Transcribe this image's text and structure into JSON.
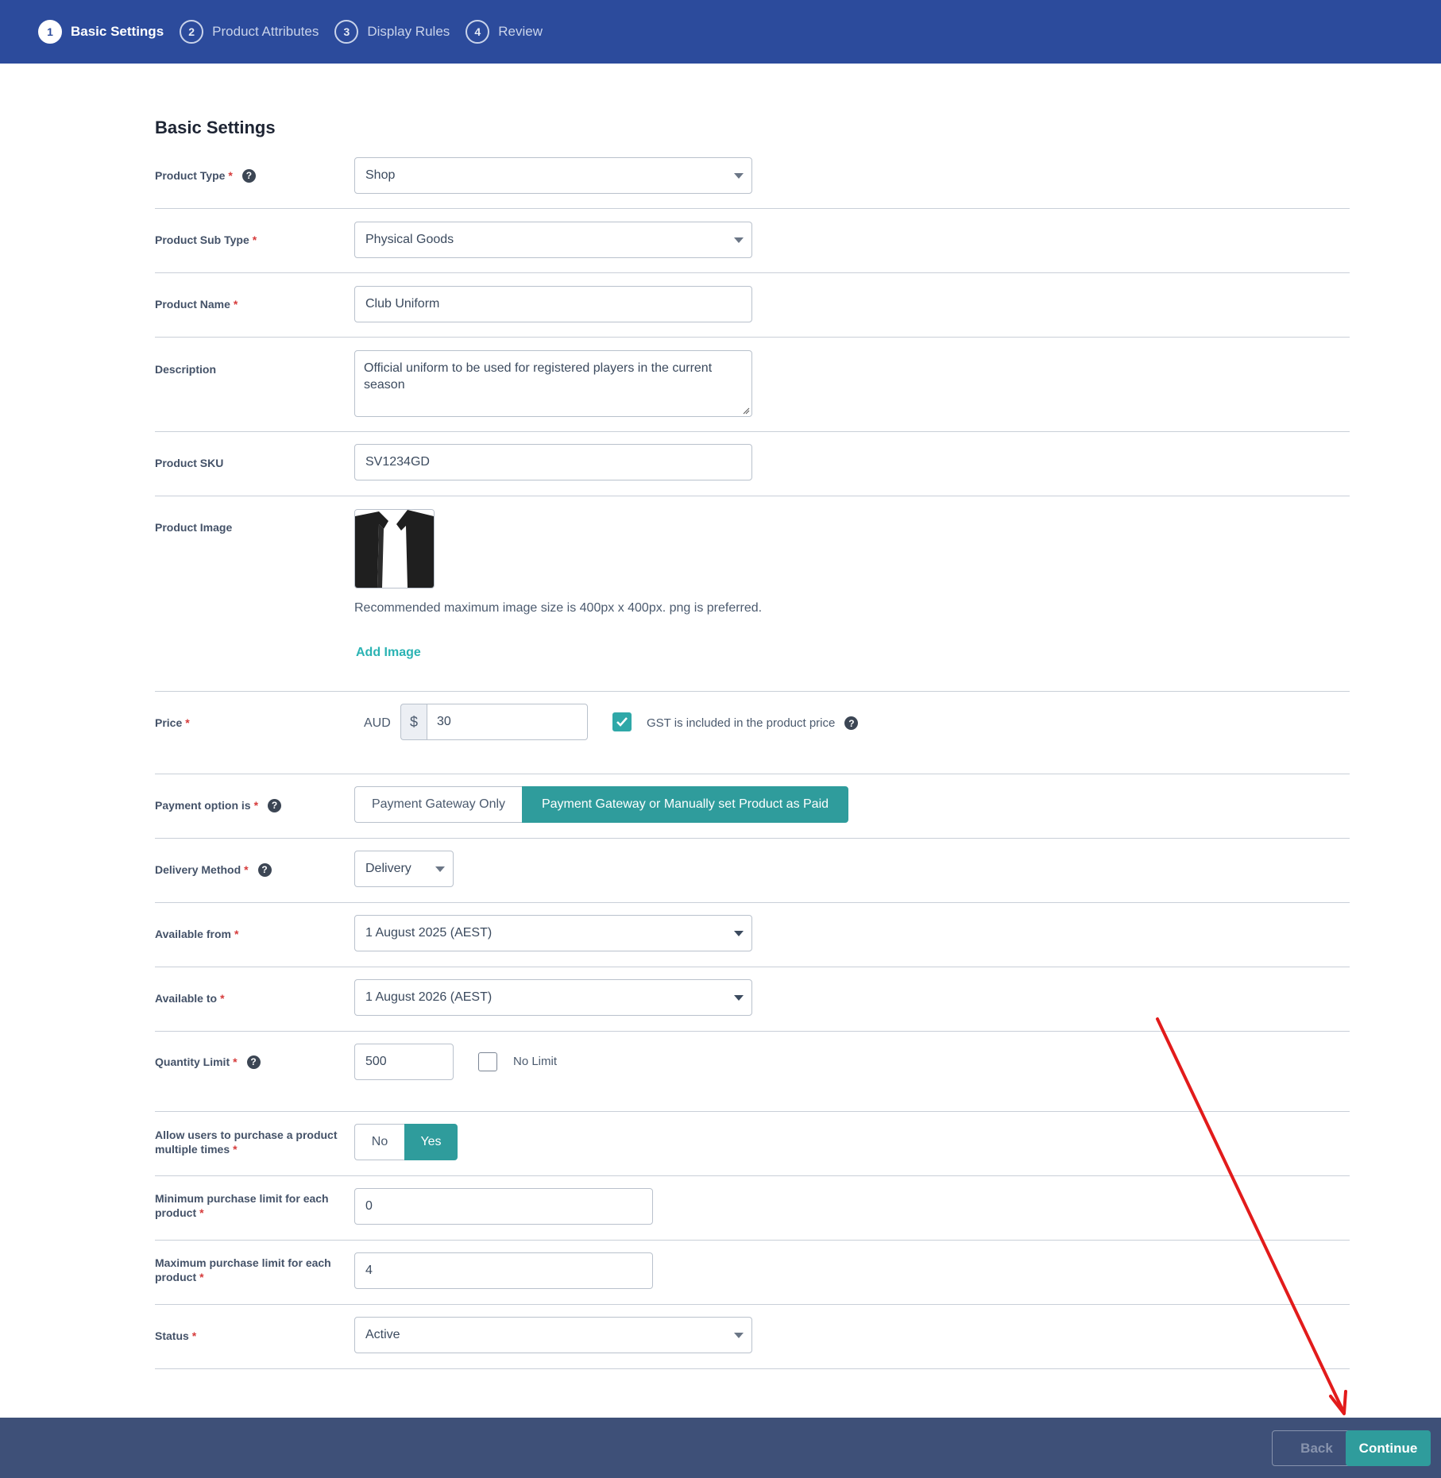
{
  "stepper": {
    "steps": [
      {
        "num": "1",
        "label": "Basic Settings"
      },
      {
        "num": "2",
        "label": "Product Attributes"
      },
      {
        "num": "3",
        "label": "Display Rules"
      },
      {
        "num": "4",
        "label": "Review"
      }
    ],
    "active_step": 1
  },
  "section_title": "Basic Settings",
  "required_mark": "*",
  "help_glyph": "?",
  "fields": {
    "product_type": {
      "label": "Product Type",
      "value": "Shop"
    },
    "product_sub_type": {
      "label": "Product Sub Type",
      "value": "Physical Goods"
    },
    "product_name": {
      "label": "Product Name",
      "value": "Club Uniform"
    },
    "description": {
      "label": "Description",
      "value": "Official uniform to be used for registered players in the current season"
    },
    "product_sku": {
      "label": "Product SKU",
      "value": "SV1234GD"
    },
    "product_image": {
      "label": "Product Image",
      "hint": "Recommended maximum image size is 400px x 400px. png is preferred.",
      "add_link": "Add Image"
    },
    "price": {
      "label": "Price",
      "currency": "AUD",
      "symbol": "$",
      "value": "30",
      "gst_checked": true,
      "gst_label": "GST is included in the product price"
    },
    "payment_option": {
      "label": "Payment option is",
      "options": [
        "Payment Gateway Only",
        "Payment Gateway or Manually set Product as Paid"
      ],
      "selected": "Payment Gateway or Manually set Product as Paid"
    },
    "delivery_method": {
      "label": "Delivery Method",
      "value": "Delivery"
    },
    "available_from": {
      "label": "Available from",
      "value": "1 August 2025 (AEST)"
    },
    "available_to": {
      "label": "Available to",
      "value": "1 August 2026 (AEST)"
    },
    "quantity_limit": {
      "label": "Quantity Limit",
      "value": "500",
      "no_limit_label": "No Limit",
      "no_limit_checked": false
    },
    "multiple_purchase": {
      "label_line1": "Allow users to purchase a product",
      "label_line2": "multiple times",
      "options": [
        "No",
        "Yes"
      ],
      "selected": "Yes"
    },
    "min_purchase": {
      "label_line1": "Minimum purchase limit for each",
      "label_line2": "product",
      "value": "0"
    },
    "max_purchase": {
      "label_line1": "Maximum purchase limit for each",
      "label_line2": "product",
      "value": "4"
    },
    "status": {
      "label": "Status",
      "value": "Active"
    }
  },
  "footer": {
    "back_label": "Back",
    "continue_label": "Continue"
  },
  "colors": {
    "header_blue": "#2c4b9c",
    "accent_teal": "#2f9c9c",
    "footer_navy": "#3e5078",
    "required_red": "#d63b3b",
    "annotation_red": "#e21b1b"
  },
  "annotation": {
    "type": "arrow",
    "points_to": "continue-button"
  }
}
